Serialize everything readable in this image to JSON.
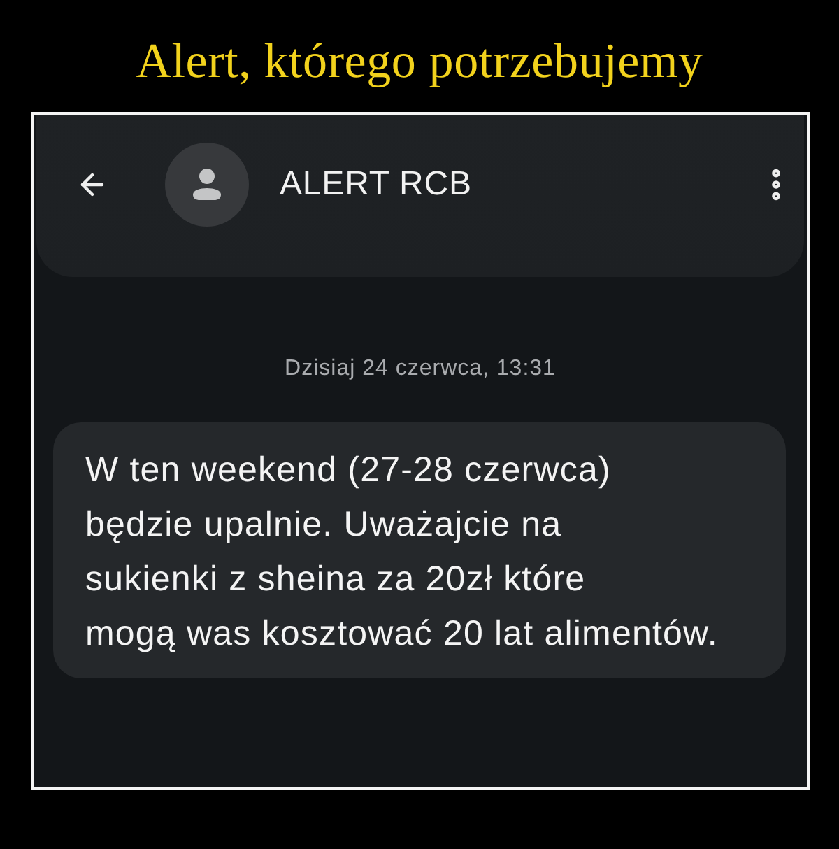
{
  "poster": {
    "title": "Alert, którego potrzebujemy"
  },
  "header": {
    "contact_name": "ALERT RCB"
  },
  "conversation": {
    "date": "Dzisiaj 24 czerwca, 13:31",
    "messages": [
      {
        "text": "W ten weekend (27-28 czerwca)\nbędzie upalnie. Uważajcie na\nsukienki z sheina za 20zł które\nmogą was kosztować 20 lat alimentów."
      }
    ]
  }
}
